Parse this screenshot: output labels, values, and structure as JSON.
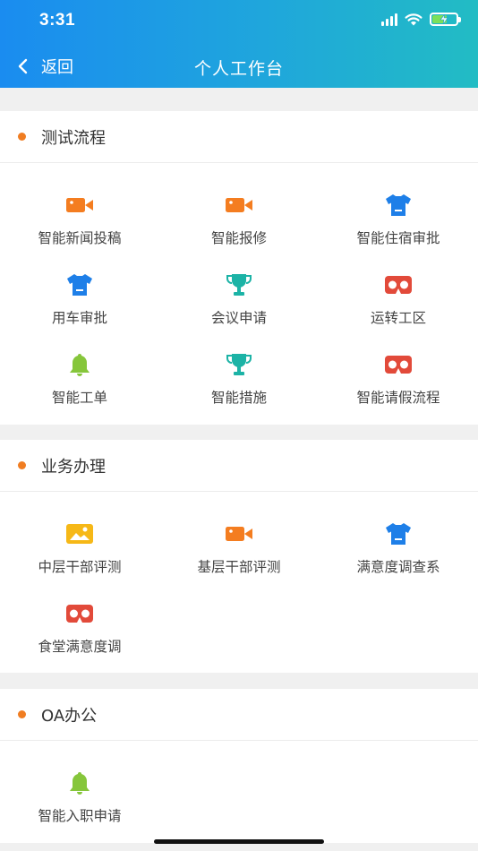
{
  "status_bar": {
    "time": "3:31"
  },
  "nav": {
    "back_label": "返回",
    "title": "个人工作台"
  },
  "colors": {
    "header_start": "#1a8cf0",
    "header_end": "#22bcc4",
    "dot": "#f07d22"
  },
  "sections": [
    {
      "title": "测试流程",
      "items": [
        {
          "label": "智能新闻投稿",
          "icon": "video-camera-icon"
        },
        {
          "label": "智能报修",
          "icon": "video-camera-icon"
        },
        {
          "label": "智能住宿审批",
          "icon": "tshirt-icon"
        },
        {
          "label": "用车审批",
          "icon": "tshirt-icon"
        },
        {
          "label": "会议申请",
          "icon": "trophy-icon"
        },
        {
          "label": "运转工区",
          "icon": "vr-glasses-icon"
        },
        {
          "label": "智能工单",
          "icon": "bell-icon"
        },
        {
          "label": "智能措施",
          "icon": "trophy-icon"
        },
        {
          "label": "智能请假流程",
          "icon": "vr-glasses-icon"
        }
      ]
    },
    {
      "title": "业务办理",
      "items": [
        {
          "label": "中层干部评测",
          "icon": "image-icon"
        },
        {
          "label": "基层干部评测",
          "icon": "video-camera-icon"
        },
        {
          "label": "满意度调查系",
          "icon": "tshirt-icon"
        },
        {
          "label": "食堂满意度调",
          "icon": "vr-glasses-icon"
        }
      ]
    },
    {
      "title": "OA办公",
      "items": [
        {
          "label": "智能入职申请",
          "icon": "bell-icon"
        }
      ]
    }
  ]
}
